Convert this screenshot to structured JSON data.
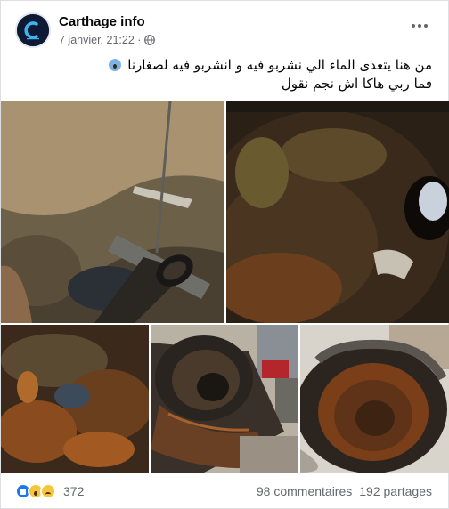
{
  "post": {
    "page_name": "Carthage info",
    "timestamp": "7 janvier, 21:22 ·",
    "audience_icon": "globe-icon",
    "more_icon": "more-dots-icon",
    "text_line1": "من هنا يتعدى الماء الي نشربو فيه و انشربو  فيه لصغارنا",
    "text_line1_emoji": "scream-emoji",
    "text_line2": "فما ربي هاكا اش نجم نقول"
  },
  "photos": [
    {
      "name": "excavation-pipe-photo"
    },
    {
      "name": "pipe-interior-closeup-photo"
    },
    {
      "name": "rusted-pipe-wall-photo"
    },
    {
      "name": "cut-pipe-end-photo"
    },
    {
      "name": "corroded-pipe-mouth-photo"
    }
  ],
  "footer": {
    "reaction_icons": [
      "like-icon",
      "wow-icon",
      "sad-icon"
    ],
    "reaction_count": "372",
    "comments": "98 commentaires",
    "shares": "192 partages"
  },
  "colors": {
    "text_primary": "#050505",
    "text_secondary": "#65676b",
    "like_blue": "#1877f2",
    "emoji_yellow": "#f7c53a"
  }
}
